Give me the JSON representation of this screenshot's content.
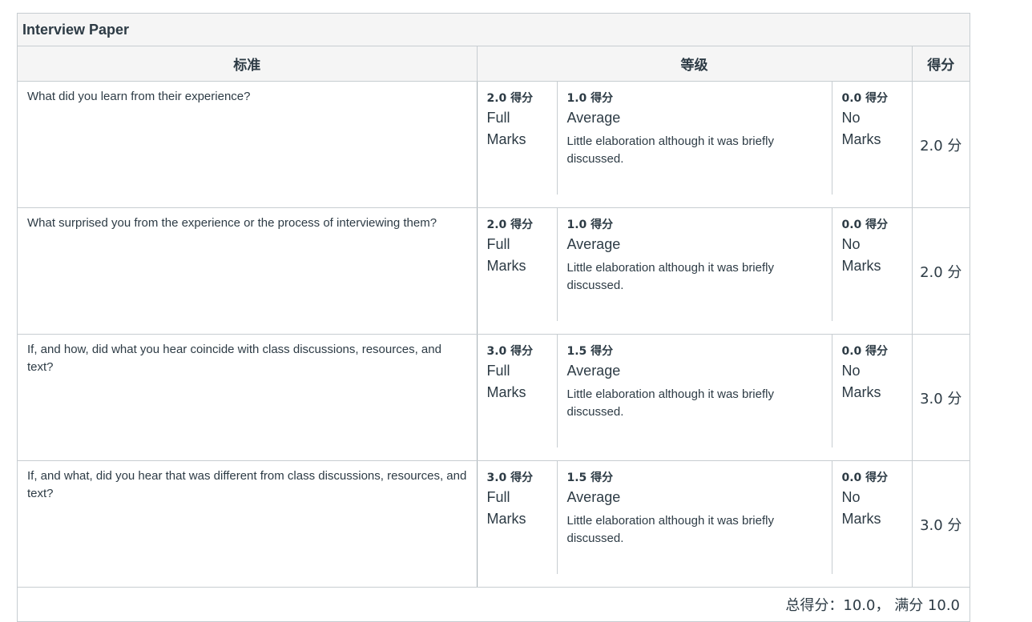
{
  "rubric": {
    "title": "Interview Paper",
    "headers": {
      "criteria": "标准",
      "ratings": "等级",
      "points": "得分"
    },
    "rows": [
      {
        "description": "What did you learn from their experience?",
        "ratings": [
          {
            "points": "2.0 得分",
            "name": "Full Marks",
            "description": ""
          },
          {
            "points": "1.0 得分",
            "name": "Average",
            "description": "Little elaboration although it was briefly discussed."
          },
          {
            "points": "0.0 得分",
            "name": "No Marks",
            "description": ""
          }
        ],
        "score": "2.0 分"
      },
      {
        "description": "What surprised you from the experience or the process of interviewing them?",
        "ratings": [
          {
            "points": "2.0 得分",
            "name": "Full Marks",
            "description": ""
          },
          {
            "points": "1.0 得分",
            "name": "Average",
            "description": "Little elaboration although it was briefly discussed."
          },
          {
            "points": "0.0 得分",
            "name": "No Marks",
            "description": ""
          }
        ],
        "score": "2.0 分"
      },
      {
        "description": "If, and how, did what you hear coincide with class discussions, resources, and text?",
        "ratings": [
          {
            "points": "3.0 得分",
            "name": "Full Marks",
            "description": ""
          },
          {
            "points": "1.5 得分",
            "name": "Average",
            "description": "Little elaboration although it was briefly discussed."
          },
          {
            "points": "0.0 得分",
            "name": "No Marks",
            "description": ""
          }
        ],
        "score": "3.0 分"
      },
      {
        "description": "If, and what, did you hear that was different from class discussions, resources, and text?",
        "ratings": [
          {
            "points": "3.0 得分",
            "name": "Full Marks",
            "description": ""
          },
          {
            "points": "1.5 得分",
            "name": "Average",
            "description": "Little elaboration although it was briefly discussed."
          },
          {
            "points": "0.0 得分",
            "name": "No Marks",
            "description": ""
          }
        ],
        "score": "3.0 分"
      }
    ],
    "total": "总得分：10.0， 满分 10.0"
  }
}
